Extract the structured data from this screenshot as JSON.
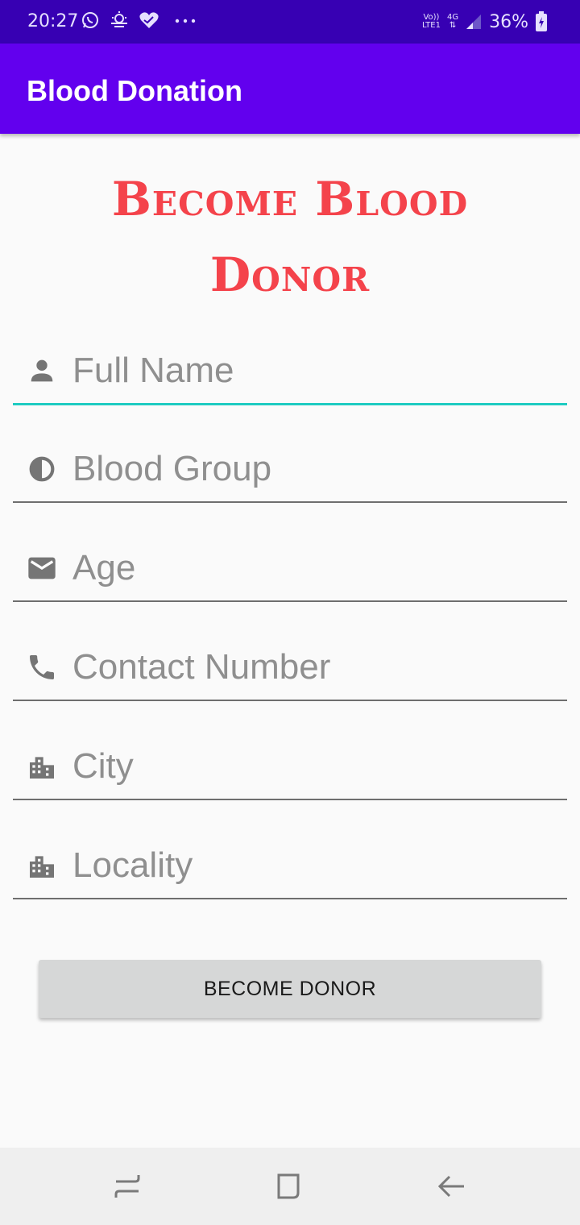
{
  "status_bar": {
    "time": "20:27",
    "battery_percent": "36%",
    "network_top": "Vo))",
    "network_bottom": "LTE1",
    "network_type": "4G",
    "icons": [
      "whatsapp-icon",
      "weather-icon",
      "heart-icon",
      "more-dots-icon",
      "signal-icon",
      "battery-icon"
    ]
  },
  "app_bar": {
    "title": "Blood Donation"
  },
  "heading": {
    "line1": "Become Blood",
    "line2": "Donor"
  },
  "form": {
    "fields": [
      {
        "placeholder": "Full Name",
        "value": "",
        "icon": "person-icon"
      },
      {
        "placeholder": "Blood Group",
        "value": "",
        "icon": "blood-drop-icon"
      },
      {
        "placeholder": "Age",
        "value": "",
        "icon": "mail-icon"
      },
      {
        "placeholder": "Contact Number",
        "value": "",
        "icon": "phone-icon"
      },
      {
        "placeholder": "City",
        "value": "",
        "icon": "city-icon"
      },
      {
        "placeholder": "Locality",
        "value": "",
        "icon": "city-icon"
      }
    ],
    "submit_label": "BECOME DONOR"
  },
  "colors": {
    "status_bar": "#3700b3",
    "app_bar": "#6200ee",
    "heading": "#f4434b",
    "focus_underline": "#1ecbc1",
    "button": "#d6d7d7"
  },
  "nav_bar": {
    "icons": [
      "recents-icon",
      "home-icon",
      "back-icon"
    ]
  }
}
